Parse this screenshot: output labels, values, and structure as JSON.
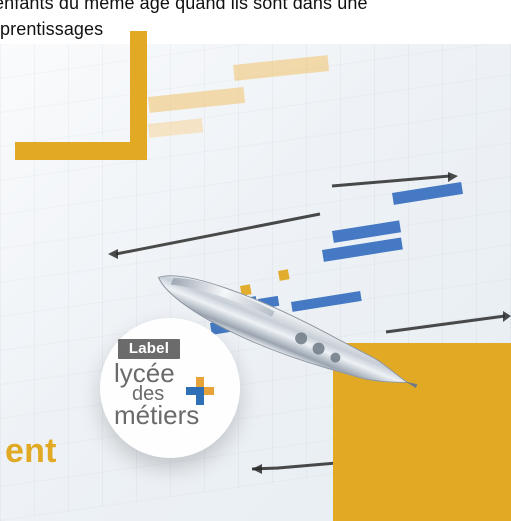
{
  "top_text": {
    "line1": "enfants du même âge quand ils sont dans une",
    "line2": "prentissages"
  },
  "badge": {
    "label": "Label",
    "line1": "lycée",
    "line2": "des",
    "line3": "métiers"
  },
  "bottom_text": "ent",
  "colors": {
    "accent_yellow": "#e2aa24",
    "badge_gray": "#6b6b6b",
    "plus_blue": "#2f6fb5",
    "plus_orange": "#e7a23a"
  }
}
